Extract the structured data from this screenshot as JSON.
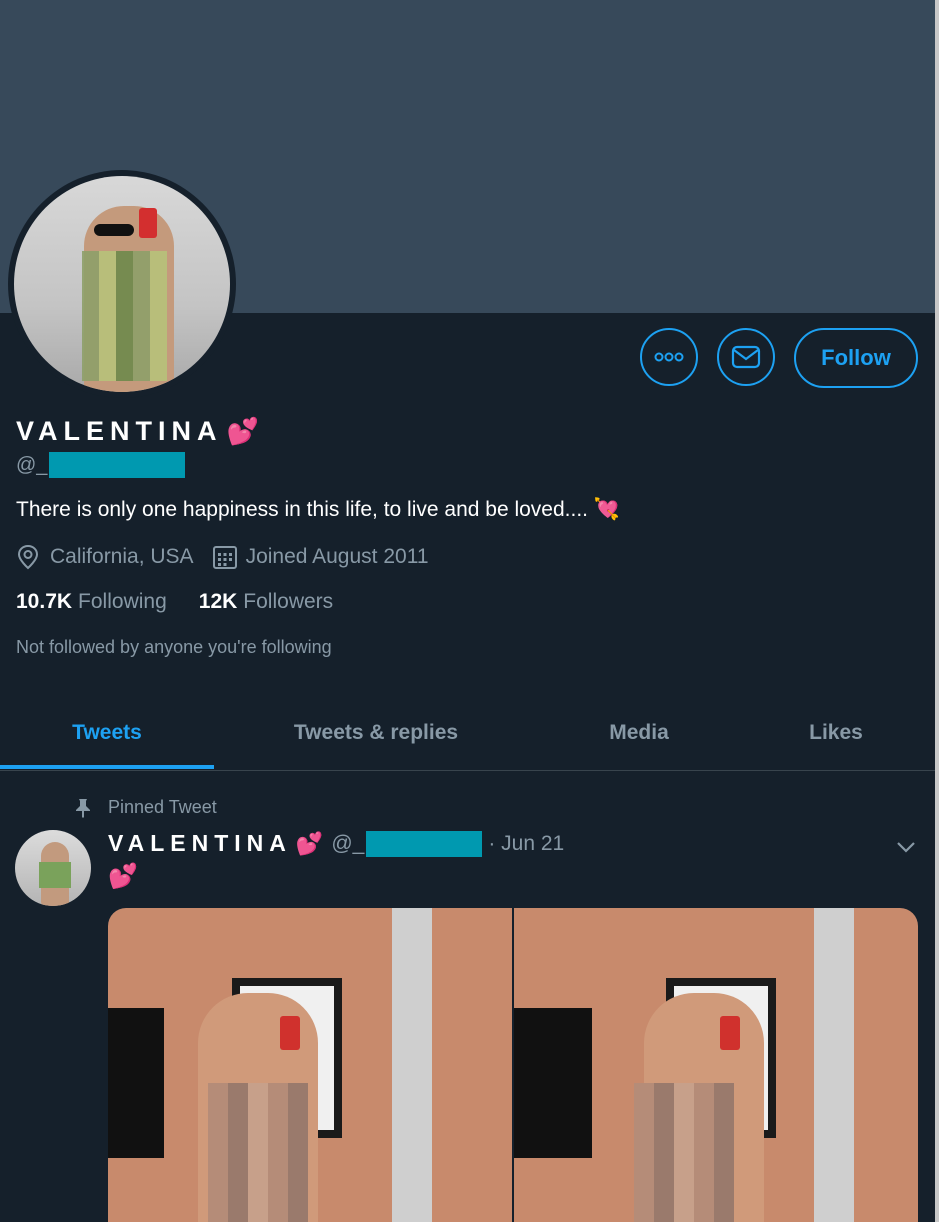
{
  "profile": {
    "display_name": "VALENTINA",
    "name_emoji": "💕",
    "handle_prefix": "@_",
    "bio": "There is only one happiness in this life, to live and be loved.... ",
    "bio_emoji": "💘",
    "location": "California, USA",
    "joined": "Joined August 2011",
    "following_count": "10.7K",
    "following_label": "Following",
    "followers_count": "12K",
    "followers_label": "Followers",
    "not_followed": "Not followed by anyone you're following"
  },
  "actions": {
    "follow_label": "Follow"
  },
  "tabs": [
    {
      "label": "Tweets",
      "active": true
    },
    {
      "label": "Tweets & replies",
      "active": false
    },
    {
      "label": "Media",
      "active": false
    },
    {
      "label": "Likes",
      "active": false
    }
  ],
  "tweet": {
    "pinned_label": "Pinned Tweet",
    "author": "VALENTINA",
    "author_emoji": "💕",
    "handle_prefix": "@_",
    "date": "· Jun 21",
    "text": "💕"
  },
  "colors": {
    "accent": "#1da1f2",
    "background": "#15202b",
    "banner": "#37495a",
    "muted": "#8899a6",
    "redaction": "#0099b0"
  },
  "icons": [
    "more-icon",
    "envelope-icon",
    "location-pin-icon",
    "calendar-icon",
    "pin-icon",
    "chevron-down-icon"
  ]
}
